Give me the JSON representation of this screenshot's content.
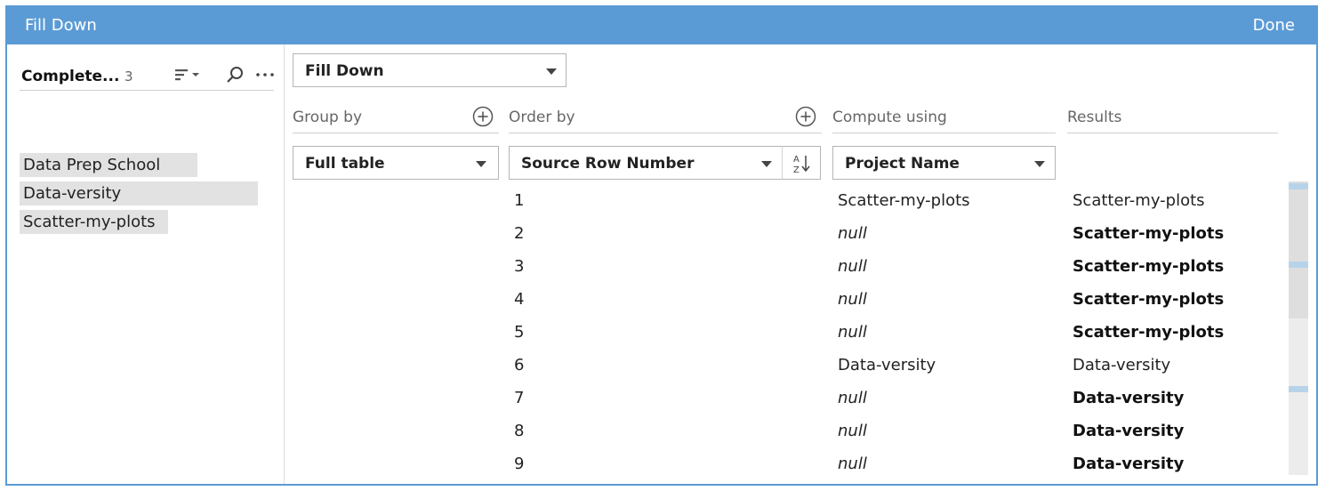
{
  "titlebar": {
    "title": "Fill Down",
    "done_label": "Done"
  },
  "left_panel": {
    "title": "Complete...",
    "count": "3",
    "values": [
      "Data Prep School",
      "Data-versity",
      "Scatter-my-plots"
    ]
  },
  "calculation": {
    "selected": "Fill Down"
  },
  "columns": {
    "group_by": {
      "label": "Group by",
      "selected": "Full table"
    },
    "order_by": {
      "label": "Order by",
      "selected": "Source Row Number"
    },
    "compute_using": {
      "label": "Compute using",
      "selected": "Project Name"
    },
    "results": {
      "label": "Results"
    }
  },
  "rows": [
    {
      "order": "1",
      "compute": "Scatter-my-plots",
      "result": "Scatter-my-plots",
      "is_null": false
    },
    {
      "order": "2",
      "compute": "null",
      "result": "Scatter-my-plots",
      "is_null": true
    },
    {
      "order": "3",
      "compute": "null",
      "result": "Scatter-my-plots",
      "is_null": true
    },
    {
      "order": "4",
      "compute": "null",
      "result": "Scatter-my-plots",
      "is_null": true
    },
    {
      "order": "5",
      "compute": "null",
      "result": "Scatter-my-plots",
      "is_null": true
    },
    {
      "order": "6",
      "compute": "Data-versity",
      "result": "Data-versity",
      "is_null": false
    },
    {
      "order": "7",
      "compute": "null",
      "result": "Data-versity",
      "is_null": true
    },
    {
      "order": "8",
      "compute": "null",
      "result": "Data-versity",
      "is_null": true
    },
    {
      "order": "9",
      "compute": "null",
      "result": "Data-versity",
      "is_null": true
    }
  ],
  "colors": {
    "accent": "#5b9bd5",
    "highlight": "#e2e2e2",
    "scroll_marker": "#b7d3ea"
  },
  "icons": [
    "sort-icon",
    "search-icon",
    "more-icon",
    "add-icon",
    "sort-az-icon",
    "chevron-down-icon"
  ]
}
